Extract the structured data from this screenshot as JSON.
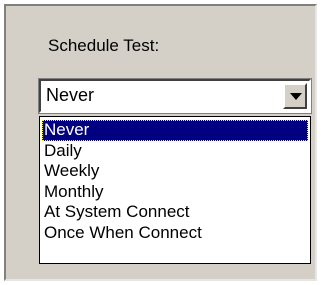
{
  "schedule": {
    "label": "Schedule Test:",
    "selected_value": "Never",
    "options": [
      "Never",
      "Daily",
      "Weekly",
      "Monthly",
      "At System Connect",
      "Once When Connect"
    ],
    "highlighted_index": 0
  },
  "colors": {
    "panel_bg": "#d4d0c8",
    "selection_bg": "#000080",
    "selection_text": "#ffffff"
  }
}
